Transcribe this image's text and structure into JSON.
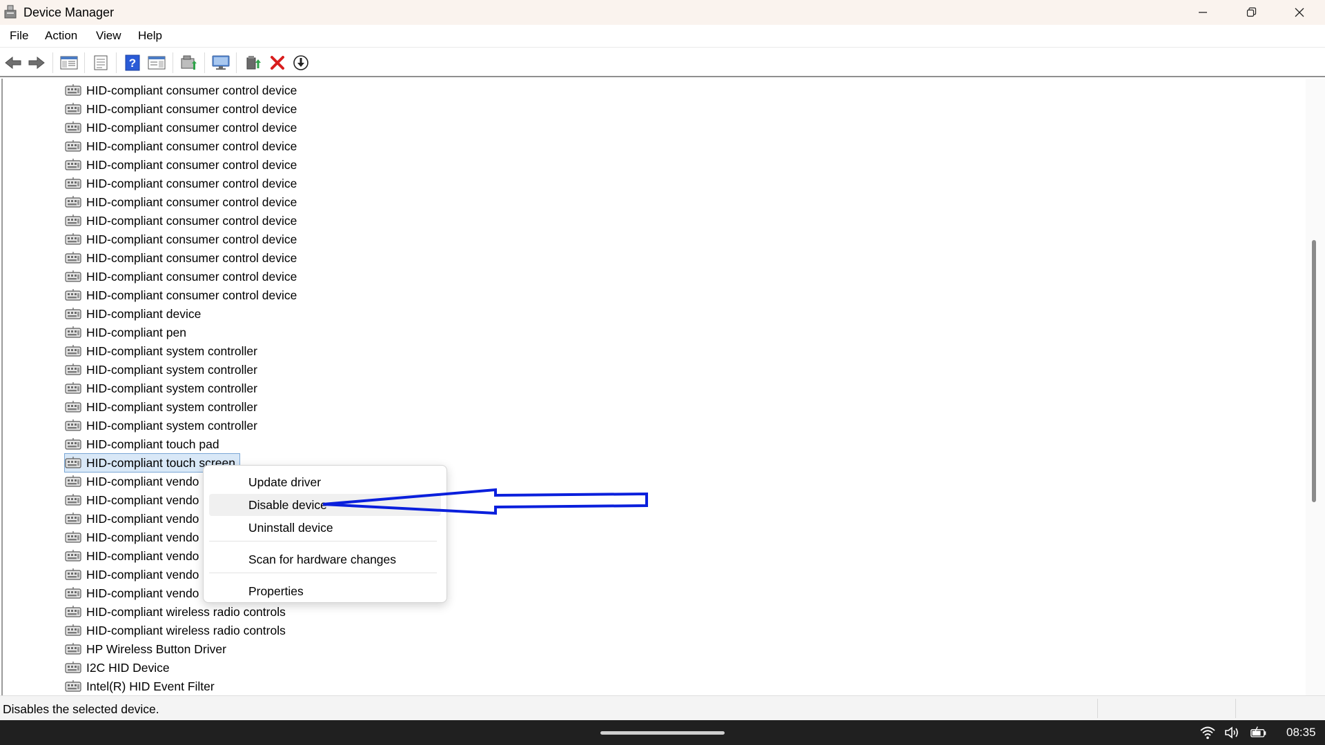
{
  "window": {
    "title": "Device Manager",
    "controls": [
      "minimize",
      "restore",
      "close"
    ]
  },
  "menubar": {
    "items": [
      "File",
      "Action",
      "View",
      "Help"
    ]
  },
  "toolbar": {
    "icons": [
      "back-icon",
      "forward-icon",
      "show-hide-console-tree-icon",
      "properties-icon",
      "help-icon",
      "action-pane-icon",
      "update-driver-icon",
      "scan-hardware-icon",
      "enable-device-icon",
      "uninstall-icon",
      "disable-icon"
    ]
  },
  "tree": {
    "items": [
      {
        "label": "HID-compliant consumer control device"
      },
      {
        "label": "HID-compliant consumer control device"
      },
      {
        "label": "HID-compliant consumer control device"
      },
      {
        "label": "HID-compliant consumer control device"
      },
      {
        "label": "HID-compliant consumer control device"
      },
      {
        "label": "HID-compliant consumer control device"
      },
      {
        "label": "HID-compliant consumer control device"
      },
      {
        "label": "HID-compliant consumer control device"
      },
      {
        "label": "HID-compliant consumer control device"
      },
      {
        "label": "HID-compliant consumer control device"
      },
      {
        "label": "HID-compliant consumer control device"
      },
      {
        "label": "HID-compliant consumer control device"
      },
      {
        "label": "HID-compliant device"
      },
      {
        "label": "HID-compliant pen"
      },
      {
        "label": "HID-compliant system controller"
      },
      {
        "label": "HID-compliant system controller"
      },
      {
        "label": "HID-compliant system controller"
      },
      {
        "label": "HID-compliant system controller"
      },
      {
        "label": "HID-compliant system controller"
      },
      {
        "label": "HID-compliant touch pad"
      },
      {
        "label": "HID-compliant touch screen",
        "selected": true
      },
      {
        "label": "HID-compliant vendo"
      },
      {
        "label": "HID-compliant vendo"
      },
      {
        "label": "HID-compliant vendo"
      },
      {
        "label": "HID-compliant vendo"
      },
      {
        "label": "HID-compliant vendo"
      },
      {
        "label": "HID-compliant vendo"
      },
      {
        "label": "HID-compliant vendo"
      },
      {
        "label": "HID-compliant wireless radio controls"
      },
      {
        "label": "HID-compliant wireless radio controls"
      },
      {
        "label": "HP Wireless Button Driver"
      },
      {
        "label": "I2C HID Device"
      },
      {
        "label": "Intel(R) HID Event Filter"
      }
    ]
  },
  "context_menu": {
    "items": [
      {
        "label": "Update driver"
      },
      {
        "label": "Disable device",
        "highlighted": true
      },
      {
        "label": "Uninstall device"
      },
      {
        "label": "Scan for hardware changes"
      },
      {
        "label": "Properties"
      }
    ]
  },
  "annotation": {
    "arrow_color": "#0a1fdc",
    "points_to": "Disable device"
  },
  "statusbar": {
    "text": "Disables the selected device."
  },
  "taskbar": {
    "clock": "08:35",
    "tray_icons": [
      "wifi-icon",
      "volume-icon",
      "battery-charging-icon"
    ]
  },
  "colors": {
    "titlebar_bg": "#faf3ee",
    "selection_bg": "#d9e8f7",
    "taskbar_bg": "#202020",
    "disable_icon_red": "#d81e1e",
    "help_icon_blue": "#2a5bd7"
  }
}
